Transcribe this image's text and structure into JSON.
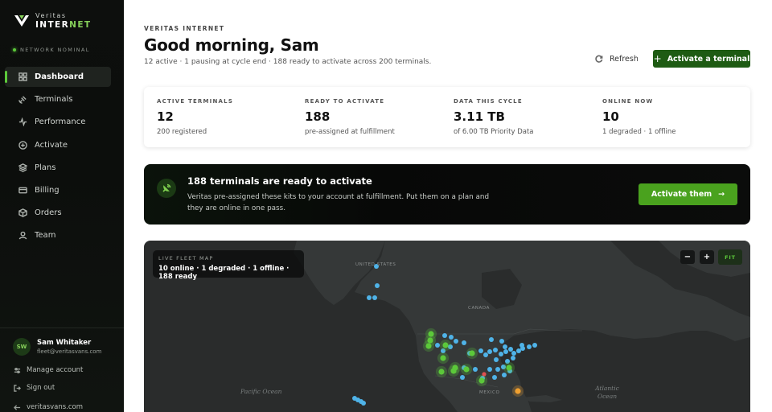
{
  "brand": {
    "top": "Veritas",
    "bottom_main": "INTER",
    "bottom_accent": "NET"
  },
  "sidebar": {
    "network_status": "NETWORK NOMINAL",
    "items": [
      {
        "label": "Dashboard",
        "icon": "dashboard-icon"
      },
      {
        "label": "Terminals",
        "icon": "satellite-icon"
      },
      {
        "label": "Performance",
        "icon": "pulse-icon"
      },
      {
        "label": "Activate",
        "icon": "plus-circle-icon"
      },
      {
        "label": "Plans",
        "icon": "layers-icon"
      },
      {
        "label": "Billing",
        "icon": "card-icon"
      },
      {
        "label": "Orders",
        "icon": "box-icon"
      },
      {
        "label": "Team",
        "icon": "user-icon"
      }
    ],
    "user": {
      "initials": "SW",
      "name": "Sam Whitaker",
      "email": "fleet@veritasvans.com"
    },
    "manage_account": "Manage account",
    "sign_out": "Sign out",
    "site_link": "veritasvans.com"
  },
  "header": {
    "eyebrow": "VERITAS INTERNET",
    "title": "Good morning, Sam",
    "subtitle": "12 active · 1 pausing at cycle end · 188 ready to activate across 200 terminals.",
    "refresh_label": "Refresh",
    "activate_label": "Activate a terminal"
  },
  "stats": [
    {
      "label": "ACTIVE TERMINALS",
      "value": "12",
      "sub": "200 registered"
    },
    {
      "label": "READY TO ACTIVATE",
      "value": "188",
      "sub": "pre-assigned at fulfillment"
    },
    {
      "label": "DATA THIS CYCLE",
      "value": "3.11 TB",
      "sub": "of 6.00 TB Priority Data"
    },
    {
      "label": "ONLINE NOW",
      "value": "10",
      "sub": "1 degraded · 1 offline"
    }
  ],
  "banner": {
    "title": "188 terminals are ready to activate",
    "body": "Veritas pre-assigned these kits to your account at fulfillment. Put them on a plan and they are online in one pass.",
    "cta": "Activate them"
  },
  "map": {
    "title": "LIVE FLEET MAP",
    "summary": "10 online · 1 degraded · 1 offline · 188 ready",
    "zoom_out": "−",
    "zoom_in": "+",
    "fit": "FIT",
    "places": {
      "usa": "UNITED STATES",
      "canada": "CANADA",
      "mexico": "MEXICO",
      "pacific": "Pacific Ocean",
      "atlantic": "Atlantic Ocean"
    },
    "colors": {
      "online": "#5cc83a",
      "ready": "#4fb3e8",
      "degraded": "#f0a030",
      "offline": "#e05050"
    }
  }
}
